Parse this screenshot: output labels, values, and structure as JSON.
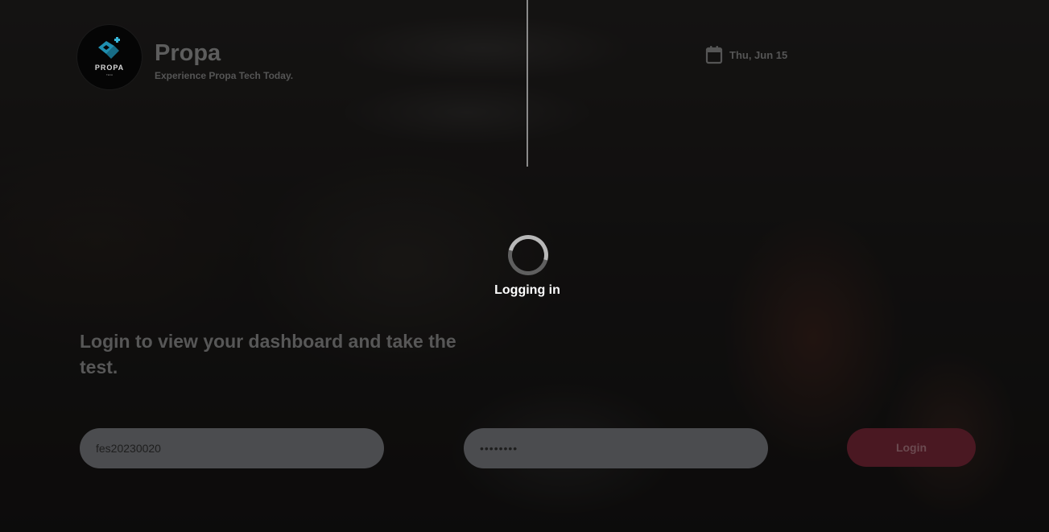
{
  "brand": {
    "logo_text": "PROPA",
    "logo_subtext": "TECH",
    "title": "Propa",
    "tagline": "Experience Propa Tech Today."
  },
  "header": {
    "date_icon": "calendar-icon",
    "date": "Thu, Jun 15"
  },
  "loading": {
    "text": "Logging in"
  },
  "main": {
    "headline": "Login to view your dashboard and take the test."
  },
  "form": {
    "username_value": "fes20230020",
    "password_value": "12345678",
    "login_label": "Login"
  },
  "colors": {
    "accent": "#4a1822",
    "logo_blue": "#1f8fb0"
  }
}
